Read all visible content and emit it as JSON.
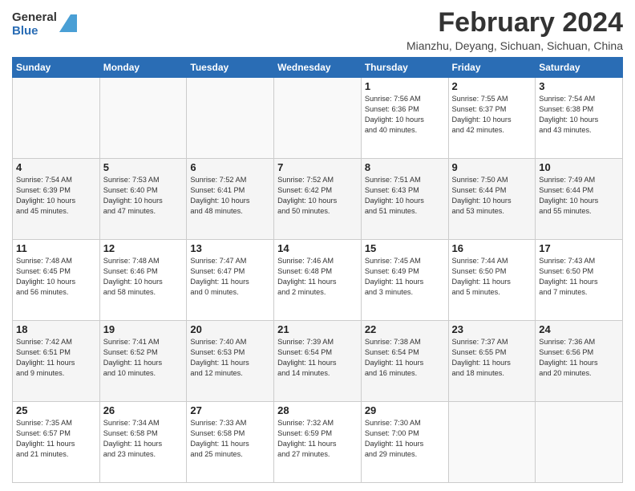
{
  "header": {
    "logo_general": "General",
    "logo_blue": "Blue",
    "title": "February 2024",
    "location": "Mianzhu, Deyang, Sichuan, Sichuan, China"
  },
  "weekdays": [
    "Sunday",
    "Monday",
    "Tuesday",
    "Wednesday",
    "Thursday",
    "Friday",
    "Saturday"
  ],
  "weeks": [
    [
      {
        "day": "",
        "info": ""
      },
      {
        "day": "",
        "info": ""
      },
      {
        "day": "",
        "info": ""
      },
      {
        "day": "",
        "info": ""
      },
      {
        "day": "1",
        "info": "Sunrise: 7:56 AM\nSunset: 6:36 PM\nDaylight: 10 hours\nand 40 minutes."
      },
      {
        "day": "2",
        "info": "Sunrise: 7:55 AM\nSunset: 6:37 PM\nDaylight: 10 hours\nand 42 minutes."
      },
      {
        "day": "3",
        "info": "Sunrise: 7:54 AM\nSunset: 6:38 PM\nDaylight: 10 hours\nand 43 minutes."
      }
    ],
    [
      {
        "day": "4",
        "info": "Sunrise: 7:54 AM\nSunset: 6:39 PM\nDaylight: 10 hours\nand 45 minutes."
      },
      {
        "day": "5",
        "info": "Sunrise: 7:53 AM\nSunset: 6:40 PM\nDaylight: 10 hours\nand 47 minutes."
      },
      {
        "day": "6",
        "info": "Sunrise: 7:52 AM\nSunset: 6:41 PM\nDaylight: 10 hours\nand 48 minutes."
      },
      {
        "day": "7",
        "info": "Sunrise: 7:52 AM\nSunset: 6:42 PM\nDaylight: 10 hours\nand 50 minutes."
      },
      {
        "day": "8",
        "info": "Sunrise: 7:51 AM\nSunset: 6:43 PM\nDaylight: 10 hours\nand 51 minutes."
      },
      {
        "day": "9",
        "info": "Sunrise: 7:50 AM\nSunset: 6:44 PM\nDaylight: 10 hours\nand 53 minutes."
      },
      {
        "day": "10",
        "info": "Sunrise: 7:49 AM\nSunset: 6:44 PM\nDaylight: 10 hours\nand 55 minutes."
      }
    ],
    [
      {
        "day": "11",
        "info": "Sunrise: 7:48 AM\nSunset: 6:45 PM\nDaylight: 10 hours\nand 56 minutes."
      },
      {
        "day": "12",
        "info": "Sunrise: 7:48 AM\nSunset: 6:46 PM\nDaylight: 10 hours\nand 58 minutes."
      },
      {
        "day": "13",
        "info": "Sunrise: 7:47 AM\nSunset: 6:47 PM\nDaylight: 11 hours\nand 0 minutes."
      },
      {
        "day": "14",
        "info": "Sunrise: 7:46 AM\nSunset: 6:48 PM\nDaylight: 11 hours\nand 2 minutes."
      },
      {
        "day": "15",
        "info": "Sunrise: 7:45 AM\nSunset: 6:49 PM\nDaylight: 11 hours\nand 3 minutes."
      },
      {
        "day": "16",
        "info": "Sunrise: 7:44 AM\nSunset: 6:50 PM\nDaylight: 11 hours\nand 5 minutes."
      },
      {
        "day": "17",
        "info": "Sunrise: 7:43 AM\nSunset: 6:50 PM\nDaylight: 11 hours\nand 7 minutes."
      }
    ],
    [
      {
        "day": "18",
        "info": "Sunrise: 7:42 AM\nSunset: 6:51 PM\nDaylight: 11 hours\nand 9 minutes."
      },
      {
        "day": "19",
        "info": "Sunrise: 7:41 AM\nSunset: 6:52 PM\nDaylight: 11 hours\nand 10 minutes."
      },
      {
        "day": "20",
        "info": "Sunrise: 7:40 AM\nSunset: 6:53 PM\nDaylight: 11 hours\nand 12 minutes."
      },
      {
        "day": "21",
        "info": "Sunrise: 7:39 AM\nSunset: 6:54 PM\nDaylight: 11 hours\nand 14 minutes."
      },
      {
        "day": "22",
        "info": "Sunrise: 7:38 AM\nSunset: 6:54 PM\nDaylight: 11 hours\nand 16 minutes."
      },
      {
        "day": "23",
        "info": "Sunrise: 7:37 AM\nSunset: 6:55 PM\nDaylight: 11 hours\nand 18 minutes."
      },
      {
        "day": "24",
        "info": "Sunrise: 7:36 AM\nSunset: 6:56 PM\nDaylight: 11 hours\nand 20 minutes."
      }
    ],
    [
      {
        "day": "25",
        "info": "Sunrise: 7:35 AM\nSunset: 6:57 PM\nDaylight: 11 hours\nand 21 minutes."
      },
      {
        "day": "26",
        "info": "Sunrise: 7:34 AM\nSunset: 6:58 PM\nDaylight: 11 hours\nand 23 minutes."
      },
      {
        "day": "27",
        "info": "Sunrise: 7:33 AM\nSunset: 6:58 PM\nDaylight: 11 hours\nand 25 minutes."
      },
      {
        "day": "28",
        "info": "Sunrise: 7:32 AM\nSunset: 6:59 PM\nDaylight: 11 hours\nand 27 minutes."
      },
      {
        "day": "29",
        "info": "Sunrise: 7:30 AM\nSunset: 7:00 PM\nDaylight: 11 hours\nand 29 minutes."
      },
      {
        "day": "",
        "info": ""
      },
      {
        "day": "",
        "info": ""
      }
    ]
  ]
}
